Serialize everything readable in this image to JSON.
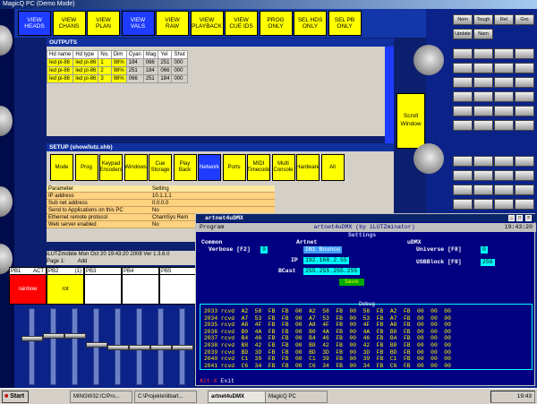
{
  "window_title": "MagicQ PC (Demo Mode)",
  "topbar": [
    {
      "label": "VIEW\nHEADS",
      "selected": true
    },
    {
      "label": "VIEW\nCHANS",
      "selected": false
    },
    {
      "label": "VIEW\nPLAN",
      "selected": false
    },
    {
      "label": "VIEW\nVALS",
      "selected": true
    },
    {
      "label": "VIEW\nRAW",
      "selected": false
    },
    {
      "label": "VIEW\nPLAYBACK",
      "selected": false
    },
    {
      "label": "VIEW\nCUE IDS",
      "selected": false
    },
    {
      "label": "PROG\nONLY",
      "selected": false
    },
    {
      "label": "SEL HDS\nONLY",
      "selected": false
    },
    {
      "label": "SEL PB\nONLY",
      "selected": false
    }
  ],
  "outputs": {
    "title": "OUTPUTS",
    "columns": [
      "Hd name",
      "Hd type",
      "No.",
      "Dim",
      "Cyan",
      "Mag",
      "Yel",
      "Shut"
    ],
    "rows": [
      [
        "led pi-86",
        "led pi-86",
        "1",
        "98%",
        "184",
        "066",
        "251",
        "000"
      ],
      [
        "led pi-86",
        "led pi-86",
        "2",
        "98%",
        "251",
        "184",
        "066",
        "000"
      ],
      [
        "led pi-86",
        "led pi-86",
        "3",
        "98%",
        "066",
        "251",
        "184",
        "000"
      ]
    ]
  },
  "scroll_window_label": "Scroll\nWindow",
  "setup": {
    "title": "SETUP (show/lutz.shb)",
    "buttons": [
      {
        "label": "Mode",
        "selected": false
      },
      {
        "label": "Prog",
        "selected": false
      },
      {
        "label": "Keypad\nEncoders",
        "selected": false
      },
      {
        "label": "Windows",
        "selected": false
      },
      {
        "label": "Cue\nStorage",
        "selected": false
      },
      {
        "label": "Play\nBack",
        "selected": false
      },
      {
        "label": "Network",
        "selected": true
      },
      {
        "label": "Ports",
        "selected": false
      },
      {
        "label": "MIDI\nTimecode",
        "selected": false
      },
      {
        "label": "Multi\nConsole",
        "selected": false
      },
      {
        "label": "Hardware",
        "selected": false
      },
      {
        "label": "All",
        "selected": false
      }
    ],
    "param_header": [
      "Parameter",
      "Setting"
    ],
    "params": [
      [
        "IP address",
        "10.1.1.1"
      ],
      [
        "Sub net address",
        "0.0.0.0"
      ],
      [
        "Send to Applications on this PC",
        "No"
      ],
      [
        "Ethernet remote protocol",
        "ChamSys Rem"
      ],
      [
        "Web server enabled",
        "No"
      ]
    ]
  },
  "status": {
    "line1": "iLUTZmobile  Mon Oct 20 19:43:20 2008 Ver 1.3.6.0",
    "line2_left": "Page 1:",
    "line2_right": "Add"
  },
  "playbacks": [
    {
      "name": "PB1",
      "tag": "ACT",
      "content": "rainbow",
      "color": "#ff0000",
      "text_color": "#ffffff"
    },
    {
      "name": "PB2",
      "tag": "(1)",
      "content": "rot",
      "color": "#ffff00",
      "text_color": "#000000"
    },
    {
      "name": "PB3",
      "tag": "",
      "content": "",
      "color": "#ffffff",
      "text_color": "#000000"
    },
    {
      "name": "PB4",
      "tag": "",
      "content": "",
      "color": "#ffffff",
      "text_color": "#000000"
    },
    {
      "name": "PB5",
      "tag": "",
      "content": "",
      "color": "#ffffff",
      "text_color": "#000000"
    }
  ],
  "fader_levels": [
    0.62,
    0.66,
    0.66,
    0.54,
    0.5,
    0.5,
    0.5,
    0.5
  ],
  "right_buttons": {
    "row1": [
      "Nom",
      "Tough",
      "Rel",
      "Gro"
    ],
    "row2": [
      "Update",
      "Nam"
    ]
  },
  "artnet": {
    "window_title": "artnet4uDMX",
    "bar_left": "Program",
    "bar_mid": "artnet4uDMX  (by iLUTZminator)",
    "bar_right": "19:43:20",
    "settings_label": "Settings",
    "common_label": "Common",
    "verbose_label": "Verbose [F2]",
    "verbose_value": "9",
    "artnet_label": "Artnet",
    "artnet_mode": "IN1 Bounce",
    "ip_label": "IP",
    "ip_value": "192.168.2.55",
    "bcast_label": "BCast",
    "bcast_value": "255.255.255.255",
    "save_label": "Save",
    "udmx_label": "uDMX",
    "universe_label": "Universe [F8]",
    "universe_value": "0",
    "usbblock_label": "USBBlock [F9]",
    "usbblock_value": "256",
    "debug_label": "Debug",
    "debug_lines": [
      "2033 rcvd  A2  58  FB  FB  00  A2  58  FB  00  58  FB  A2  FB  00  00  00",
      "2034 rcvd  A7  53  FB  FB  00  A7  53  FB  00  53  FB  A7  FB  00  00  00",
      "2035 rcvd  A8  4F  FB  FB  00  A8  4F  FB  00  4F  FB  A8  FB  00  00  00",
      "2036 rcvd  B0  4A  FB  FB  00  B0  4A  FB  00  4A  FB  B0  FB  00  00  00",
      "2037 rcvd  B4  46  FB  FB  00  B4  46  FB  00  46  FB  B4  FB  00  00  00",
      "2038 rcvd  B8  42  FB  FB  00  B8  42  FB  00  42  FB  B8  FB  00  00  00",
      "2039 rcvd  BD  3D  FB  FB  00  BD  3D  FB  00  3D  FB  BD  FB  00  00  00",
      "2040 rcvd  C1  39  FB  FB  00  C1  39  FB  00  39  FB  C1  FB  00  00  00",
      "2041 rcvd  C6  34  FB  FB  00  C6  34  FB  00  34  FB  C6  FB  00  00  00"
    ],
    "foot_key": "Alt-X",
    "foot_label": "Exit"
  },
  "taskbar": {
    "start_label": "Start",
    "tasks": [
      {
        "label": "MINGW32:/C/Pro...",
        "active": false
      },
      {
        "label": "C:\\Projekte\\lilbart...",
        "active": false
      },
      {
        "label": "artnet4uDMX",
        "active": true
      },
      {
        "label": "MagicQ PC",
        "active": false
      }
    ],
    "clock": "19:43"
  },
  "colors": {
    "accent_yellow": "#ffff00",
    "selected_blue": "#1e3cff",
    "console_bg": "#0c1f6e",
    "dos_bg": "#000080",
    "dos_text": "#ffff00"
  }
}
